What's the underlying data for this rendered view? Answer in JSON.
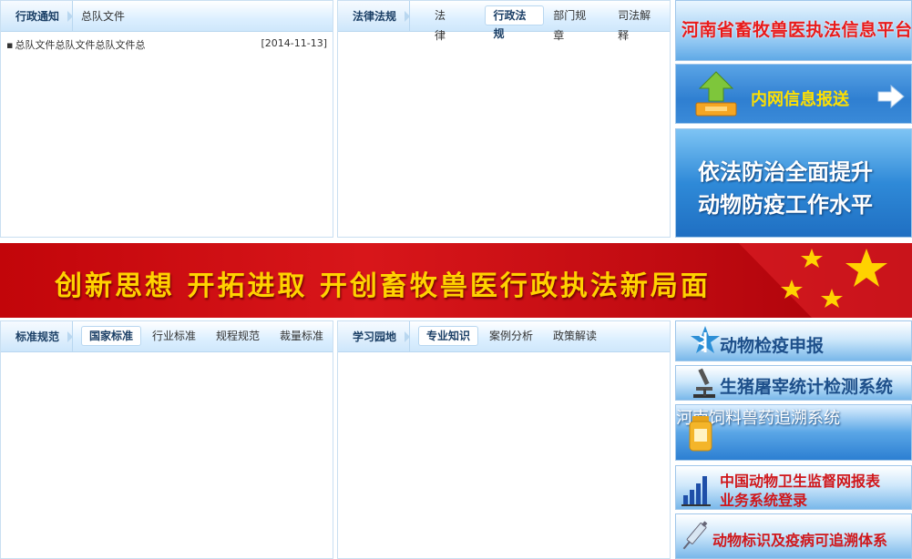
{
  "admin_notice": {
    "title": "行政通知",
    "tab": "总队文件",
    "items": [
      {
        "text": "总队文件总队文件总队文件总",
        "date": "[2014-11-13]"
      }
    ]
  },
  "laws": {
    "title": "法律法规",
    "tabs": [
      "法律",
      "行政法规",
      "部门规章",
      "司法解释"
    ],
    "active_tab": "行政法规"
  },
  "standards": {
    "title": "标准规范",
    "tabs": [
      "国家标准",
      "行业标准",
      "规程规范",
      "裁量标准"
    ],
    "active_tab": "国家标准"
  },
  "study": {
    "title": "学习园地",
    "tabs": [
      "专业知识",
      "案例分析",
      "政策解读"
    ],
    "active_tab": "专业知识"
  },
  "banner": {
    "slogan": "创新思想  开拓进取  开创畜牧兽医行政执法新局面"
  },
  "sidebar": {
    "platform": "河南省畜牧兽医执法信息平台",
    "intranet": "内网信息报送",
    "slogan_line1": "依法防治全面提升",
    "slogan_line2": "动物防疫工作水平"
  },
  "quick_links": {
    "quarantine": "动物检疫申报",
    "pig": "生猪屠宰统计检测系统",
    "feed": "河南饲料兽药追溯系统",
    "report_line1": "中国动物卫生监督网报表",
    "report_line2": "业务系统登录",
    "trace": "动物标识及疫病可追溯体系"
  },
  "colors": {
    "panel_border": "#c9dff1",
    "header_blue": "#cfe7fb",
    "banner_red": "#c2050a",
    "banner_text": "#ffd200",
    "alert_red": "#e81b1b"
  }
}
